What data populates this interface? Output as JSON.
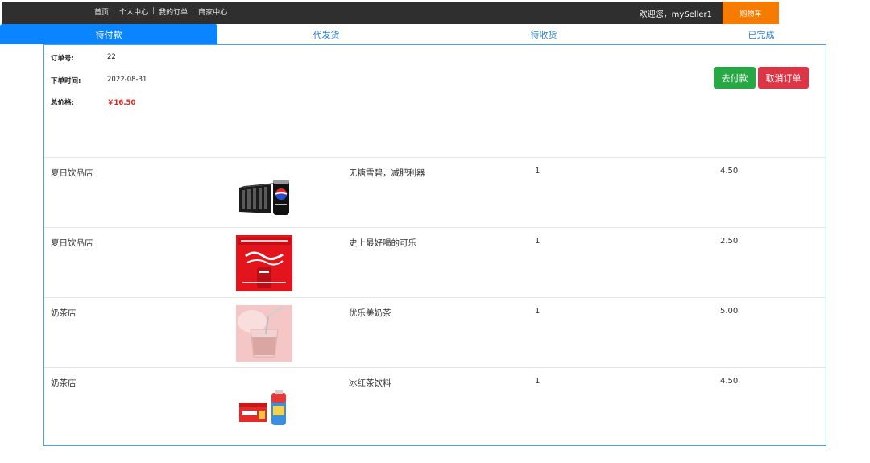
{
  "header": {
    "nav": [
      "首页",
      "个人中心",
      "我的订单",
      "商家中心"
    ],
    "separator": "|",
    "welcome": "欢迎您，mySeller1",
    "cart_label": "购物车"
  },
  "tabs": [
    {
      "label": "待付款",
      "active": true
    },
    {
      "label": "代发货",
      "active": false
    },
    {
      "label": "待收货",
      "active": false
    },
    {
      "label": "已完成",
      "active": false
    }
  ],
  "order": {
    "id_label": "订单号:",
    "id_value": "22",
    "time_label": "下单时间:",
    "time_value": "2022-08-31",
    "total_label": "总价格:",
    "total_value": "￥16.50",
    "pay_button": "去付款",
    "cancel_button": "取消订单"
  },
  "items": [
    {
      "shop": "夏日饮品店",
      "name": "无糖雪碧，减肥利器",
      "qty": "1",
      "price": "4.50",
      "image": "cola-cans-icon"
    },
    {
      "shop": "夏日饮品店",
      "name": "史上最好喝的可乐",
      "qty": "1",
      "price": "2.50",
      "image": "cola-pack-icon"
    },
    {
      "shop": "奶茶店",
      "name": "优乐美奶茶",
      "qty": "1",
      "price": "5.00",
      "image": "milk-tea-icon"
    },
    {
      "shop": "奶茶店",
      "name": "冰红茶饮料",
      "qty": "1",
      "price": "4.50",
      "image": "ice-tea-icon"
    }
  ],
  "colors": {
    "active_tab": "#0a84ff",
    "cart": "#f57c00",
    "pay": "#28a745",
    "cancel": "#dc3545",
    "price": "#d9261c"
  }
}
